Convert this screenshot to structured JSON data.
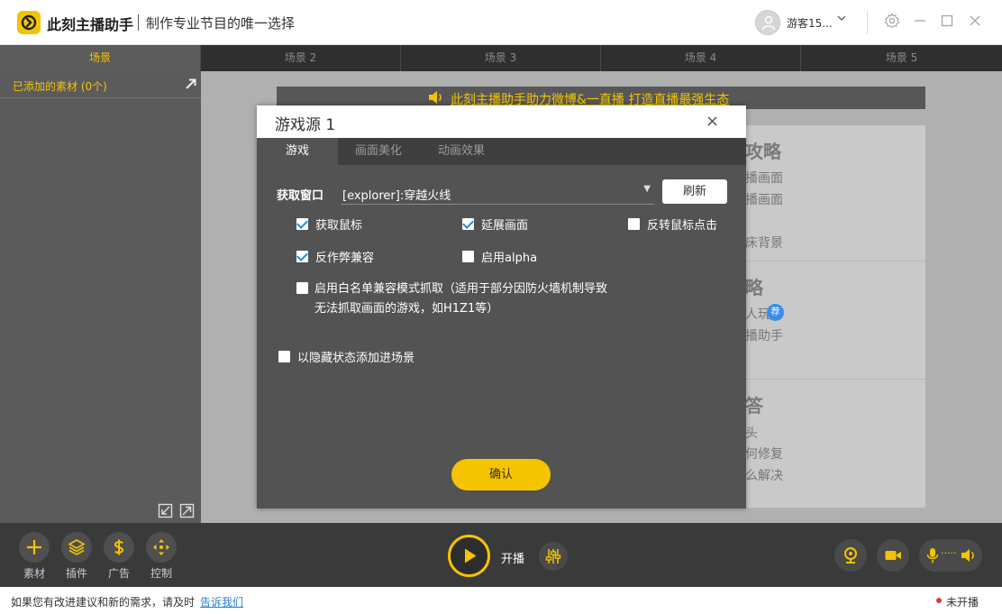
{
  "app": {
    "name": "此刻主播助手",
    "slogan": "制作专业节目的唯一选择",
    "user_name": "游客15..."
  },
  "scene_tabs": [
    {
      "label": "场景",
      "active": true
    },
    {
      "label": "场景 2",
      "active": false
    },
    {
      "label": "场景 3",
      "active": false
    },
    {
      "label": "场景 4",
      "active": false
    },
    {
      "label": "场景 5",
      "active": false
    }
  ],
  "left_panel": {
    "header": "已添加的素材 (0个)"
  },
  "preview": {
    "banner": "此刻主播助手助力微博&一直播 打造直播最强生态",
    "promo": {
      "head1": "攻略",
      "line1": "播画面",
      "line2": "播画面",
      "line3": "床背景",
      "head2": "略",
      "line4": "人玩",
      "badge": "荐",
      "line5": "播助手",
      "head3": "答",
      "line6": "头",
      "line7": "何修复",
      "line8": "么解决"
    }
  },
  "dialog": {
    "title": "游戏源 1",
    "close": "×",
    "tabs": [
      {
        "label": "游戏",
        "active": true
      },
      {
        "label": "画面美化",
        "active": false
      },
      {
        "label": "动画效果",
        "active": false
      }
    ],
    "capture_label": "获取窗口",
    "capture_value": "[explorer]:穿越火线",
    "select_arrow": "▼",
    "refresh": "刷新",
    "options": {
      "capture_mouse": {
        "label": "获取鼠标",
        "checked": true
      },
      "extend_screen": {
        "label": "延展画面",
        "checked": true
      },
      "invert_click": {
        "label": "反转鼠标点击",
        "checked": false
      },
      "anti_cheat": {
        "label": "反作弊兼容",
        "checked": true
      },
      "enable_alpha": {
        "label": "启用alpha",
        "checked": false
      },
      "whitelist_line1": "启用白名单兼容模式抓取（适用于部分因防火墙机制导致",
      "whitelist_line2": "无法抓取画面的游戏，如H1Z1等）",
      "hidden_add": {
        "label": "以隐藏状态添加进场景",
        "checked": false
      }
    },
    "confirm": "确认"
  },
  "toolbar": {
    "tools": [
      {
        "label": "素材",
        "icon": "plus-icon"
      },
      {
        "label": "插件",
        "icon": "layers-icon"
      },
      {
        "label": "广告",
        "icon": "dollar-icon"
      },
      {
        "label": "控制",
        "icon": "move-icon"
      }
    ],
    "start_live": "开播",
    "audio_dots": "·····"
  },
  "status": {
    "text": "如果您有改进建议和新的需求，请及时",
    "link": "告诉我们",
    "live_state": "未开播"
  },
  "colors": {
    "accent": "#f5c400",
    "dark": "#3a3a3a",
    "link": "#2a7fd4",
    "check": "#2a8ad8",
    "status_dot": "#e03a3a"
  }
}
